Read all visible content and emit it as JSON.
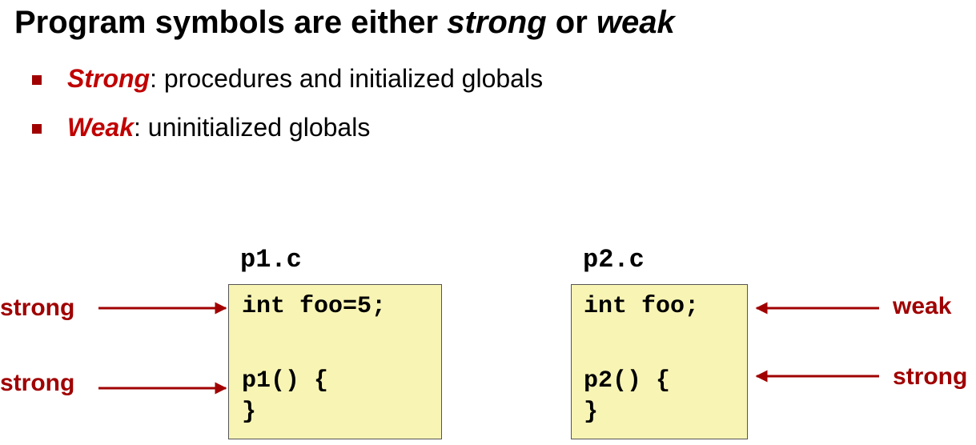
{
  "title": {
    "prefix": "Program symbols are either ",
    "strong": "strong",
    "middle": " or ",
    "weak": "weak"
  },
  "bullets": [
    {
      "keyword": "Strong",
      "text": ": procedures and initialized globals"
    },
    {
      "keyword": "Weak",
      "text": ": uninitialized globals"
    }
  ],
  "files": [
    {
      "name": "p1.c",
      "lines": [
        "int foo=5;",
        "p1() {",
        "}"
      ]
    },
    {
      "name": "p2.c",
      "lines": [
        "int foo;",
        "p2() {",
        "}"
      ]
    }
  ],
  "annotations": {
    "p1_line1": "strong",
    "p1_line2": "strong",
    "p2_line1": "weak",
    "p2_line2": "strong"
  },
  "colors": {
    "accent": "#c00000",
    "label": "#a00000",
    "code_background": "#f8f4b4"
  }
}
